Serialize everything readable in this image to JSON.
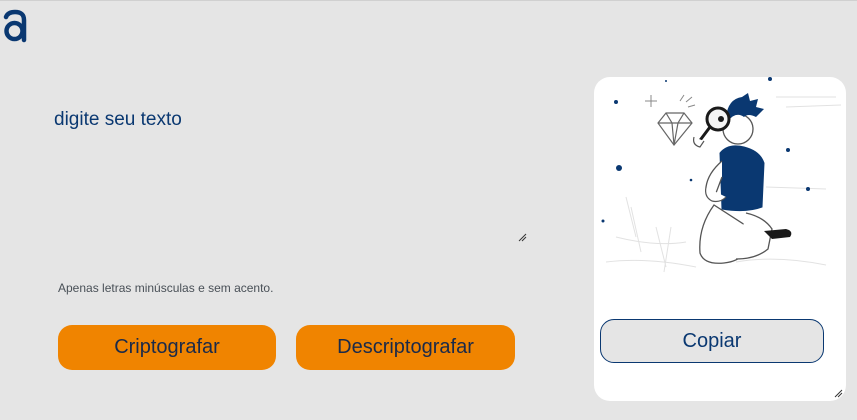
{
  "logo": {
    "icon": "logo-a-icon",
    "color": "#0a3871"
  },
  "input": {
    "placeholder": "digite seu texto",
    "value": ""
  },
  "hint": {
    "text": "Apenas letras minúsculas e sem acento.",
    "icon": "info-icon"
  },
  "buttons": {
    "encrypt_label": "Criptografar",
    "decrypt_label": "Descriptografar",
    "copy_label": "Copiar"
  },
  "output": {
    "illustration": "person-with-magnifying-glass-illustration"
  },
  "colors": {
    "background": "#e5e5e5",
    "primary": "#0a3871",
    "accent": "#f08400",
    "card": "#ffffff"
  }
}
